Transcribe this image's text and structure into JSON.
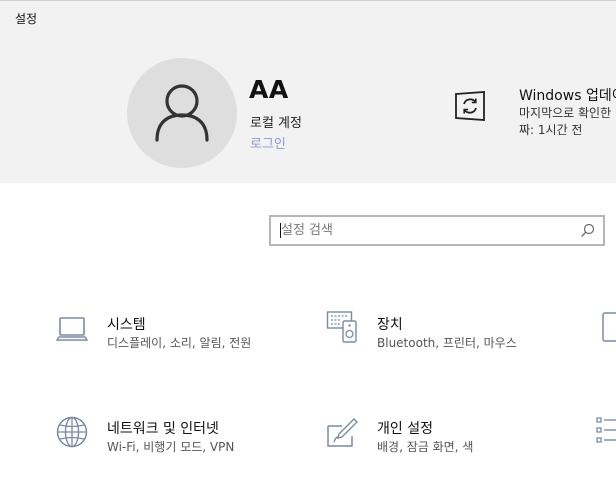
{
  "window": {
    "title": "설정"
  },
  "account": {
    "name": "AA",
    "type": "로컬 계정",
    "login_link": "로그인"
  },
  "update": {
    "title": "Windows 업데이트",
    "line1": "마지막으로 확인한",
    "line2": "짜: 1시간 전"
  },
  "search": {
    "placeholder": "설정 검색",
    "value": ""
  },
  "categories": [
    {
      "title": "시스템",
      "desc": "디스플레이, 소리, 알림, 전원",
      "icon": "laptop-icon"
    },
    {
      "title": "장치",
      "desc": "Bluetooth, 프린터, 마우스",
      "icon": "devices-icon"
    },
    {
      "title": "네트워크 및 인터넷",
      "desc": "Wi-Fi, 비행기 모드, VPN",
      "icon": "globe-icon"
    },
    {
      "title": "개인 설정",
      "desc": "배경, 잠금 화면, 색",
      "icon": "pen-tablet-icon"
    }
  ],
  "colors": {
    "accent": "#8d9bd1",
    "hero_bg": "#f2f2f2",
    "icon": "#7b8ba3"
  }
}
